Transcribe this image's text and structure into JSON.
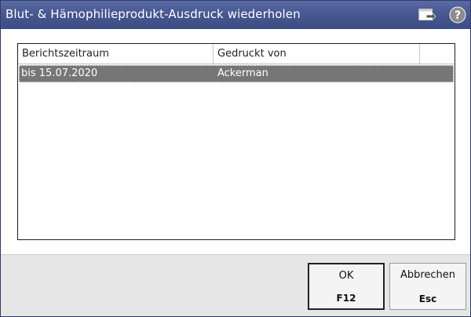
{
  "window": {
    "title": "Blut- & Hämophilieprodukt-Ausdruck wiederholen",
    "icons": [
      "export-icon",
      "help-icon"
    ]
  },
  "table": {
    "columns": [
      "Berichtszeitraum",
      "Gedruckt von",
      ""
    ],
    "rows": [
      {
        "berichtszeitraum": "bis 15.07.2020",
        "gedruckt_von": "Ackerman",
        "selected": true
      }
    ]
  },
  "buttons": {
    "ok": {
      "label": "OK",
      "key": "F12"
    },
    "cancel": {
      "label": "Abbrechen",
      "key": "Esc"
    }
  },
  "colors": {
    "titlebar": "#46568f",
    "selected_row": "#767676",
    "footer": "#e6e6e6"
  }
}
